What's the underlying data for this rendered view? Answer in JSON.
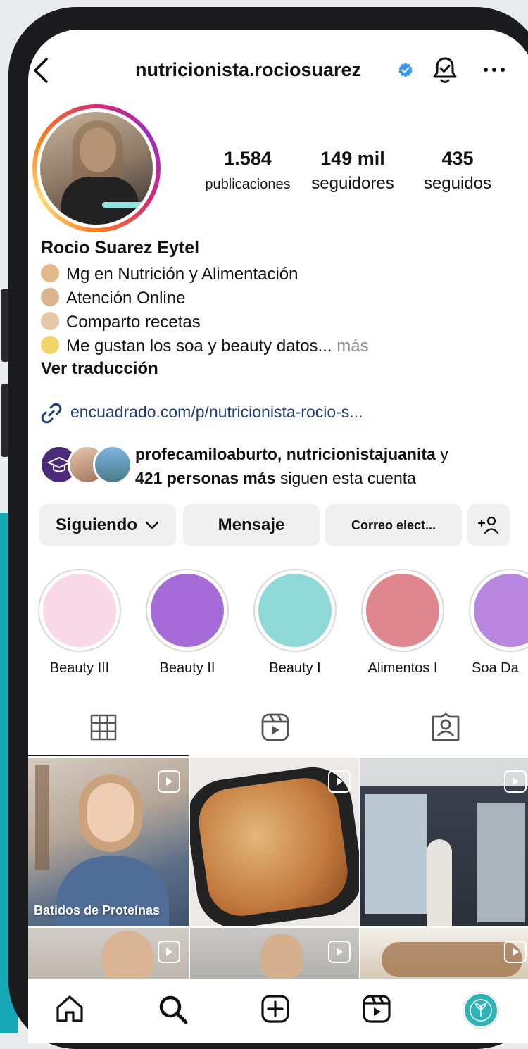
{
  "header": {
    "username": "nutricionista.rociosuarez",
    "back_icon": "chevron-left-icon",
    "verified_icon": "verified-badge-icon",
    "bell_icon": "bell-icon",
    "menu_icon": "more-horizontal-icon"
  },
  "stats": [
    {
      "num": "1.584",
      "label": "publicaciones"
    },
    {
      "num": "149 mil",
      "label": "seguidores"
    },
    {
      "num": "435",
      "label": "seguidos"
    }
  ],
  "bio": {
    "name": "Rocio Suarez Eytel",
    "lines": [
      "Mg en Nutrición y Alimentación",
      "Atención Online",
      "Comparto recetas",
      "Me gustan los soa y beauty datos..."
    ],
    "more": "más",
    "translate": "Ver traducción",
    "link": "encuadrado.com/p/nutricionista-rocio-s..."
  },
  "followed_by": {
    "names": "profecamiloaburto, nutricionistajuanita",
    "conj": "y",
    "count": "421 personas más",
    "suffix": "siguen esta cuenta"
  },
  "buttons": {
    "following": "Siguiendo",
    "message": "Mensaje",
    "email": "Correo elect..."
  },
  "highlights": [
    {
      "label": "Beauty III",
      "color": "#f9d8e8"
    },
    {
      "label": "Beauty II",
      "color": "#a56bd9"
    },
    {
      "label": "Beauty I",
      "color": "#8fd8d8"
    },
    {
      "label": "Alimentos I",
      "color": "#e0868e"
    },
    {
      "label": "Soa Da",
      "color": "#b987e0"
    }
  ],
  "grid": {
    "captions": [
      "Batidos de Proteínas"
    ]
  },
  "colors": {
    "link": "#1c3d78",
    "verified": "#3897f0",
    "accent_teal": "#18a9b6"
  }
}
